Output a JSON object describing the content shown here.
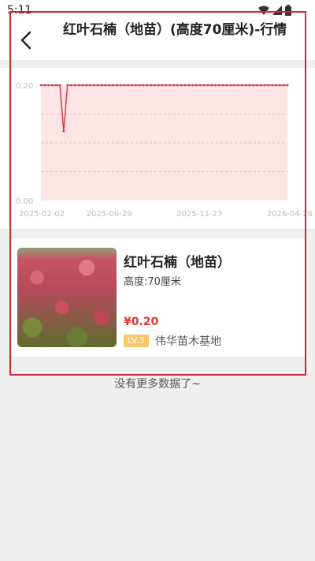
{
  "status_bar": {
    "time": "5:11"
  },
  "header": {
    "title": "红叶石楠（地苗）(高度70厘米)-行情",
    "back_icon": "chevron-left-icon"
  },
  "chart_data": {
    "type": "line",
    "title": "",
    "x_tick_labels": [
      "2025-02-02",
      "2025-06-29",
      "2025-11-23",
      "2026-04-26"
    ],
    "y_tick_labels": [
      "0.20",
      "0.00"
    ],
    "ylim": [
      0,
      0.2
    ],
    "grid": true,
    "series": [
      {
        "values": [
          0.2,
          0.2,
          0.2,
          0.2,
          0.2,
          0.2,
          0.12,
          0.2,
          0.2,
          0.2,
          0.2,
          0.2,
          0.2,
          0.2,
          0.2,
          0.2,
          0.2,
          0.2,
          0.2,
          0.2,
          0.2,
          0.2,
          0.2,
          0.2,
          0.2,
          0.2,
          0.2,
          0.2,
          0.2,
          0.2,
          0.2,
          0.2,
          0.2,
          0.2,
          0.2,
          0.2,
          0.2,
          0.2,
          0.2,
          0.2,
          0.2,
          0.2,
          0.2,
          0.2,
          0.2,
          0.2,
          0.2,
          0.2,
          0.2,
          0.2,
          0.2,
          0.2,
          0.2,
          0.2,
          0.2,
          0.2,
          0.2,
          0.2,
          0.2,
          0.2,
          0.2,
          0.2,
          0.2,
          0.2,
          0.2,
          0.2
        ]
      }
    ],
    "colors": {
      "line": "#d43a44",
      "area": "#fde4e6",
      "grid": "#e8b9bd"
    }
  },
  "product": {
    "name": "红叶石楠（地苗）",
    "spec": "高度:70厘米",
    "price": "¥0.20",
    "level": "LV.3",
    "base_name": "伟华苗木基地",
    "price_color": "#e23a2e",
    "badge_color": "#f6c86a"
  },
  "footer": {
    "no_more": "没有更多数据了~"
  }
}
